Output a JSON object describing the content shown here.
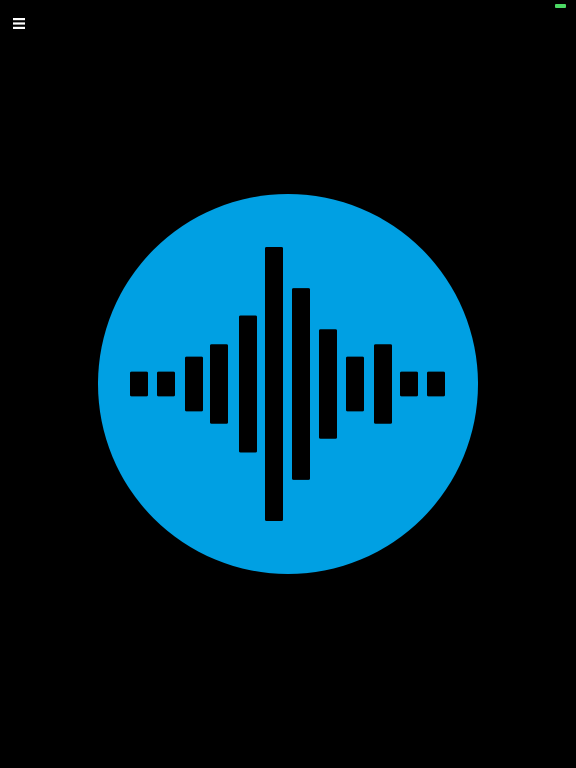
{
  "header": {
    "menu_icon": "hamburger-menu-icon",
    "battery_icon": "battery-indicator-icon"
  },
  "main": {
    "record_button_icon": "audio-waveform-icon",
    "waveform_bar_levels": [
      0.09,
      0.09,
      0.2,
      0.29,
      0.5,
      1.0,
      0.7,
      0.4,
      0.2,
      0.29,
      0.09,
      0.09
    ]
  },
  "colors": {
    "background": "#000000",
    "accent": "#00A0E3",
    "waveform": "#000000",
    "menu_icon": "#FFFFFF",
    "battery": "#4CD964"
  }
}
